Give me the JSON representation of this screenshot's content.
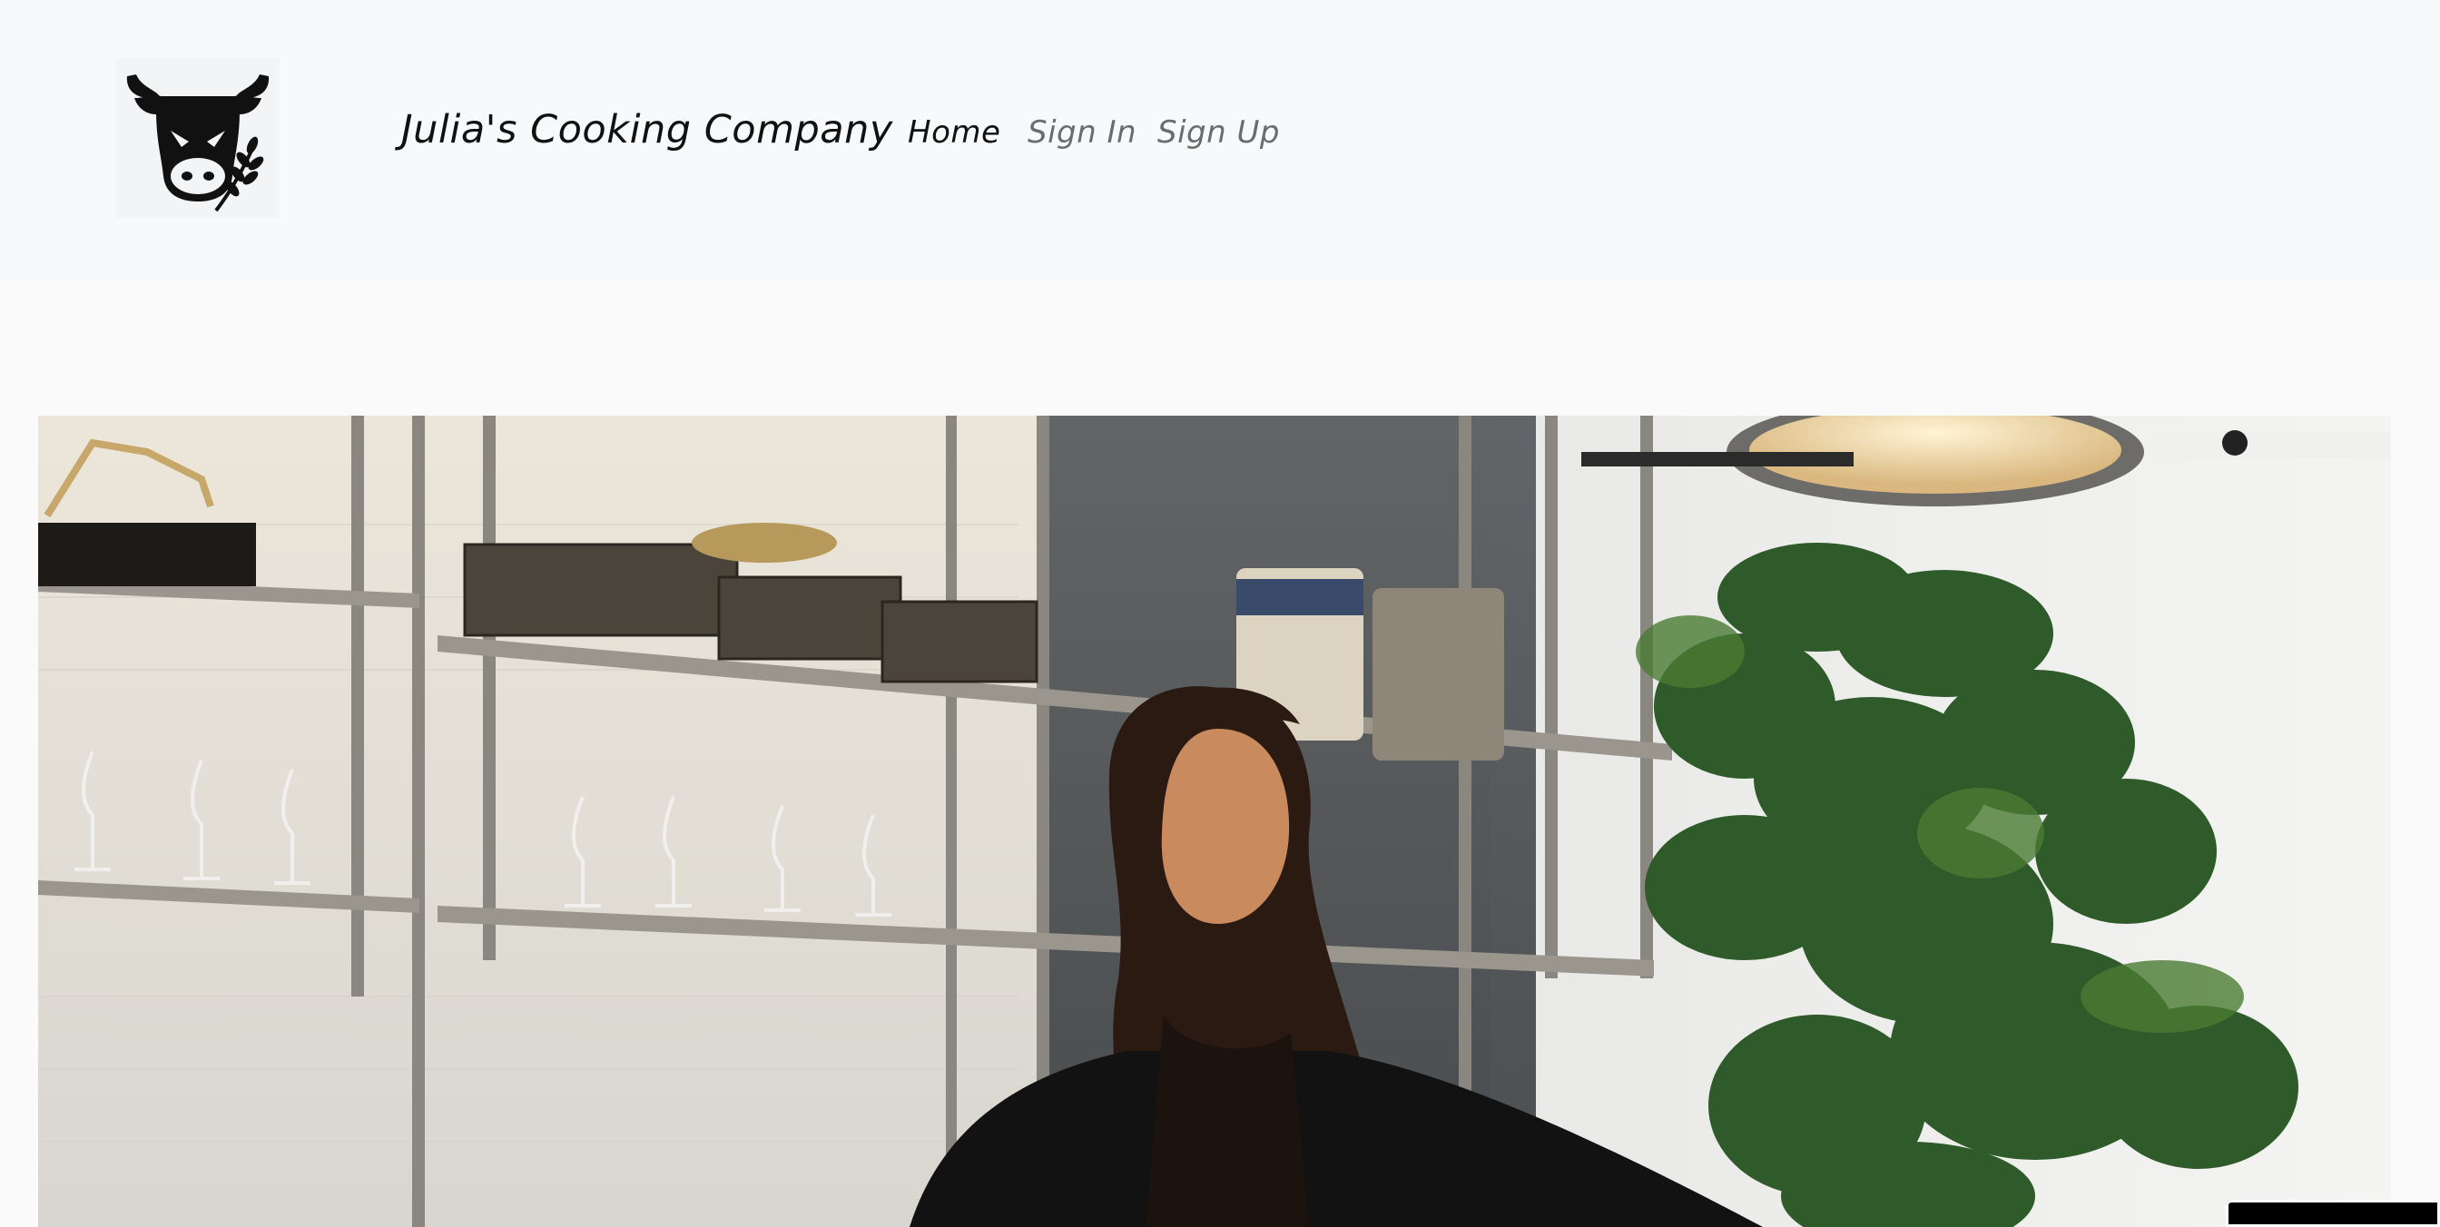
{
  "navbar": {
    "logo_icon": "cow-wheat-logo-icon",
    "brand": "Julia's Cooking Company",
    "links": [
      {
        "label": "Home",
        "active": true
      },
      {
        "label": "Sign In",
        "active": false
      },
      {
        "label": "Sign Up",
        "active": false
      }
    ]
  },
  "hero": {
    "image_icon": "hero-photo"
  },
  "colors": {
    "navbar_bg": "#f8f9fa",
    "page_bg": "#fafafa",
    "active_link": "#111111",
    "inactive_link": "#6c6c6c"
  }
}
